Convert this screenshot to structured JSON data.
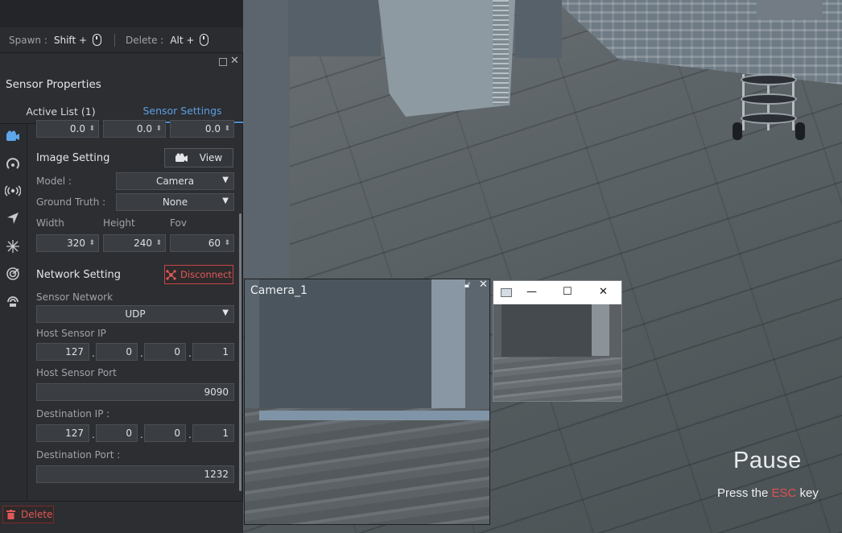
{
  "toolbar": {
    "spawn_label": "Spawn :",
    "spawn_key": "Shift +",
    "delete_label": "Delete :",
    "delete_key": "Alt +"
  },
  "panel": {
    "title": "Sensor Properties",
    "tabs": [
      {
        "label": "Active List  (1)",
        "active": false
      },
      {
        "label": "Sensor Settings",
        "active": true
      }
    ],
    "sidebar_icons": [
      "camera-icon",
      "signal-icon",
      "broadcast-icon",
      "navigation-icon",
      "network-node-icon",
      "radar-icon",
      "antenna-icon"
    ],
    "top_values": [
      "0.0",
      "0.0",
      "0.0"
    ],
    "image_setting": {
      "title": "Image Setting",
      "view_label": "View",
      "model_label": "Model :",
      "model_value": "Camera",
      "ground_truth_label": "Ground Truth :",
      "ground_truth_value": "None",
      "width_label": "Width",
      "height_label": "Height",
      "fov_label": "Fov",
      "width_value": "320",
      "height_value": "240",
      "fov_value": "60"
    },
    "network_setting": {
      "title": "Network Setting",
      "disconnect_label": "Disconnect",
      "sensor_network_label": "Sensor Network",
      "sensor_network_value": "UDP",
      "host_ip_label": "Host Sensor IP",
      "host_ip": [
        "127",
        "0",
        "0",
        "1"
      ],
      "host_port_label": "Host Sensor Port",
      "host_port": "9090",
      "dest_ip_label": "Destination IP :",
      "dest_ip": [
        "127",
        "0",
        "0",
        "1"
      ],
      "dest_port_label": "Destination Port :",
      "dest_port": "1232"
    },
    "delete_label": "Delete"
  },
  "camera_window": {
    "title": "Camera_1"
  },
  "overlay": {
    "pause": "Pause",
    "press_prefix": "Press the ",
    "press_key": "ESC",
    "press_suffix": " key"
  },
  "colors": {
    "accent": "#5b9fe0",
    "danger": "#e05a5a",
    "panel_bg": "#2c2e32"
  }
}
